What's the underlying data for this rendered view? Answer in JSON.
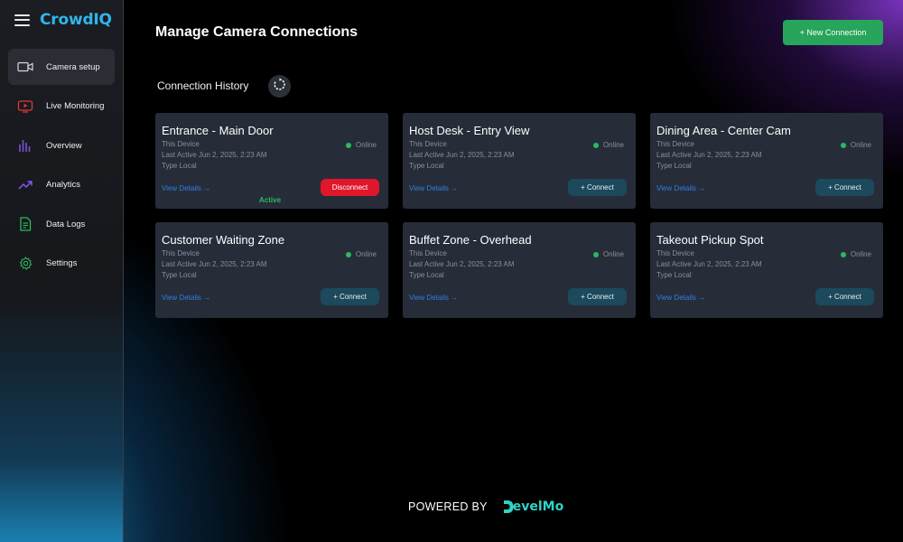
{
  "app": {
    "brand": "CrowdIQ"
  },
  "sidebar": {
    "items": [
      {
        "label": "Camera setup",
        "icon": "camera-icon",
        "active": true
      },
      {
        "label": "Live Monitoring",
        "icon": "play-screen-icon",
        "active": false
      },
      {
        "label": "Overview",
        "icon": "bar-chart-icon",
        "active": false
      },
      {
        "label": "Analytics",
        "icon": "trend-icon",
        "active": false
      },
      {
        "label": "Data Logs",
        "icon": "document-icon",
        "active": false
      },
      {
        "label": "Settings",
        "icon": "gear-icon",
        "active": false
      }
    ]
  },
  "header": {
    "title": "Manage Camera Connections",
    "new_button": "+ New Connection"
  },
  "history": {
    "title": "Connection History"
  },
  "cards": [
    {
      "title": "Entrance - Main Door",
      "device": "This Device",
      "last_active": "Last Active Jun 2, 2025, 2:23 AM",
      "type": "Type Local",
      "status": "Online",
      "details": "View Details →",
      "action": "Disconnect",
      "active_label": "Active"
    },
    {
      "title": "Host Desk - Entry View",
      "device": "This Device",
      "last_active": "Last Active Jun 2, 2025, 2:23 AM",
      "type": "Type Local",
      "status": "Online",
      "details": "View Details →",
      "action": "+ Connect",
      "active_label": ""
    },
    {
      "title": "Dining Area - Center Cam",
      "device": "This Device",
      "last_active": "Last Active Jun 2, 2025, 2:23 AM",
      "type": "Type Local",
      "status": "Online",
      "details": "View Details →",
      "action": "+ Connect",
      "active_label": ""
    },
    {
      "title": "Customer Waiting Zone",
      "device": "This Device",
      "last_active": "Last Active Jun 2, 2025, 2:23 AM",
      "type": "Type Local",
      "status": "Online",
      "details": "View Details →",
      "action": "+ Connect",
      "active_label": ""
    },
    {
      "title": "Buffet Zone - Overhead",
      "device": "This Device",
      "last_active": "Last Active Jun 2, 2025, 2:23 AM",
      "type": "Type Local",
      "status": "Online",
      "details": "View Details →",
      "action": "+ Connect",
      "active_label": ""
    },
    {
      "title": "Takeout Pickup Spot",
      "device": "This Device",
      "last_active": "Last Active Jun 2, 2025, 2:23 AM",
      "type": "Type Local",
      "status": "Online",
      "details": "View Details →",
      "action": "+ Connect",
      "active_label": ""
    }
  ],
  "footer": {
    "powered_by": "POWERED BY",
    "partner": "DevelMo"
  },
  "colors": {
    "accent": "#2fb6ea",
    "green": "#27a55a",
    "danger": "#e0162b",
    "link": "#2f7fe0"
  }
}
